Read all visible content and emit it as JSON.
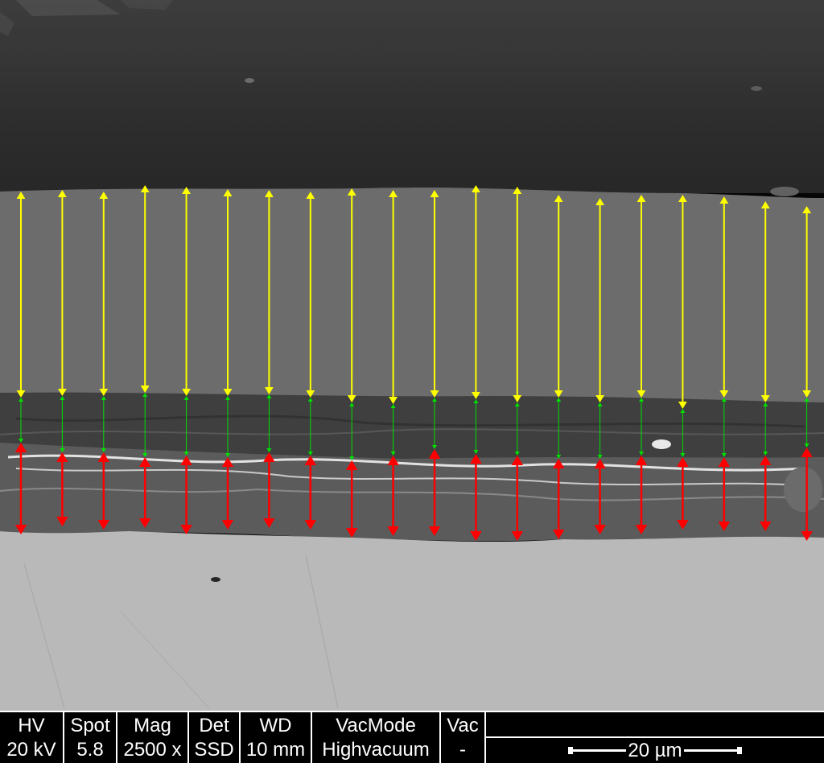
{
  "image": {
    "description_layers": [
      "mounting-resin",
      "coating-outer",
      "coating-inner",
      "oxide-interface",
      "substrate"
    ],
    "colors": {
      "resin": "#2a2a2a",
      "coating_outer": "#6e6e6e",
      "coating_inner": "#3c3c3c",
      "interface": "#5a5a5a",
      "substrate": "#bebebe",
      "yellow_arrow": "#ffff00",
      "green_arrow": "#00e000",
      "red_arrow": "#ff0000"
    },
    "arrow_count": 20
  },
  "databar": {
    "hv": {
      "label": "HV",
      "value": "20 kV"
    },
    "spot": {
      "label": "Spot",
      "value": "5.8"
    },
    "mag": {
      "label": "Mag",
      "value": "2500 x"
    },
    "det": {
      "label": "Det",
      "value": "SSD"
    },
    "wd": {
      "label": "WD",
      "value": "10 mm"
    },
    "vacmode": {
      "label": "VacMode",
      "value": "Highvacuum"
    },
    "vac": {
      "label": "Vac",
      "value": "-"
    },
    "scale": {
      "label": "20 µm"
    }
  }
}
